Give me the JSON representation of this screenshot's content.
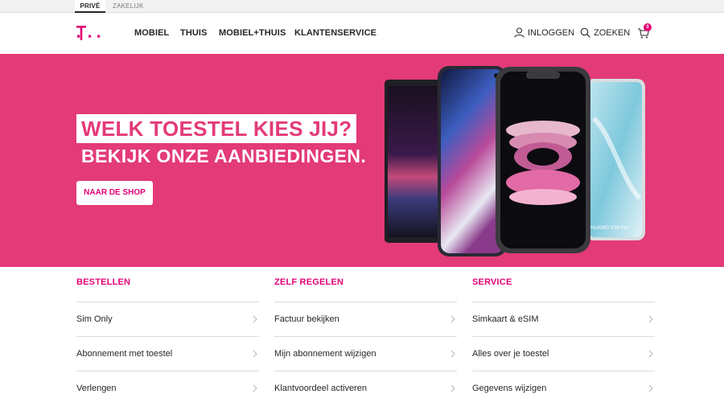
{
  "segments": {
    "prive": "PRIVÉ",
    "zakelijk": "ZAKELIJK"
  },
  "nav": {
    "items": [
      {
        "label": "MOBIEL"
      },
      {
        "label": "THUIS"
      },
      {
        "label": "MOBIEL+THUIS"
      },
      {
        "label": "KLANTENSERVICE"
      }
    ],
    "login_label": "INLOGGEN",
    "search_label": "ZOEKEN",
    "cart_count": "0"
  },
  "hero": {
    "title": "WELK TOESTEL KIES JIJ?",
    "subtitle": "BEKIJK ONZE AANBIEDINGEN.",
    "button_label": "NAAR DE SHOP",
    "phone_label": "HUAWEI P30 Pro"
  },
  "columns": [
    {
      "heading": "BESTELLEN",
      "links": [
        "Sim Only",
        "Abonnement met toestel",
        "Verlengen"
      ]
    },
    {
      "heading": "ZELF REGELEN",
      "links": [
        "Factuur bekijken",
        "Mijn abonnement wijzigen",
        "Klantvoordeel activeren"
      ]
    },
    {
      "heading": "SERVICE",
      "links": [
        "Simkaart & eSIM",
        "Alles over je toestel",
        "Gegevens wijzigen"
      ]
    }
  ],
  "colors": {
    "brand_magenta": "#e20074",
    "hero_background": "#e33a78",
    "text": "#262626"
  },
  "icons": [
    "telekom-logo-icon",
    "user-icon",
    "search-icon",
    "cart-icon",
    "chevron-right-icon"
  ]
}
